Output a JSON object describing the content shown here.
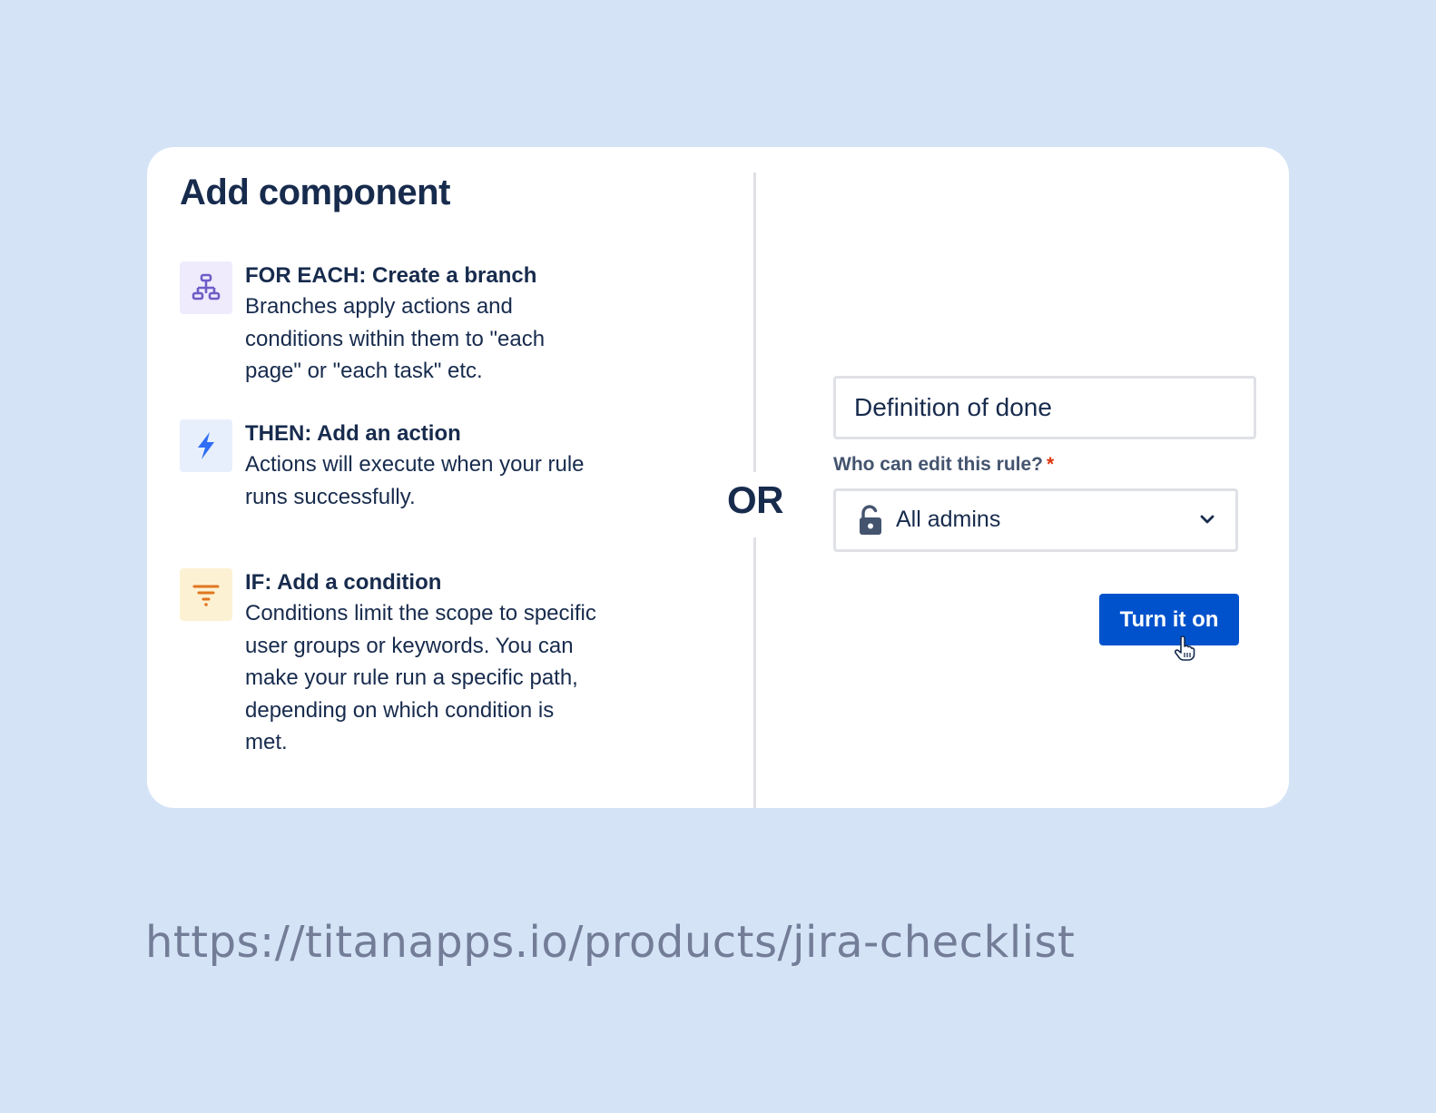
{
  "dialog": {
    "title": "Add component",
    "components": [
      {
        "icon": "branch-icon",
        "heading": "FOR EACH: Create a branch",
        "description": "Branches apply actions and conditions within them to \"each page\" or \"each task\" etc."
      },
      {
        "icon": "lightning-icon",
        "heading": "THEN: Add an action",
        "description": "Actions will execute when your rule runs successfully."
      },
      {
        "icon": "filter-icon",
        "heading": "IF: Add a condition",
        "description": "Conditions limit the scope to specific user groups or keywords. You can make your rule run a specific path, depending on which condition is met."
      }
    ],
    "separator": "OR",
    "rule_name_value": "Definition of done",
    "editor_label": "Who can edit this rule?",
    "required_marker": "*",
    "editor_select_value": "All admins",
    "turn_on_button": "Turn it on"
  },
  "footer": {
    "url": "https://titanapps.io/products/jira-checklist"
  },
  "colors": {
    "background": "#d5e3f7",
    "primary_button": "#0052cc",
    "branch_icon": "#6e5dc6",
    "action_icon": "#2f6df6",
    "condition_icon": "#e0761f",
    "required": "#de350b"
  }
}
